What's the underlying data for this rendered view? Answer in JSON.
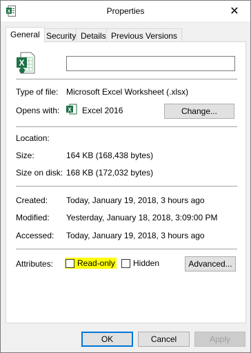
{
  "window": {
    "title": "Properties",
    "close_glyph": "✕",
    "title_icon": "excel-file-icon"
  },
  "tabs": [
    {
      "label": "General",
      "active": true
    },
    {
      "label": "Security",
      "active": false
    },
    {
      "label": "Details",
      "active": false
    },
    {
      "label": "Previous Versions",
      "active": false
    }
  ],
  "general": {
    "file_icon": "excel-file-icon",
    "file_name_value": "",
    "type_label": "Type of file:",
    "type_value": "Microsoft Excel Worksheet (.xlsx)",
    "opens_label": "Opens with:",
    "opens_app_icon": "excel-app-icon",
    "opens_value": "Excel 2016",
    "change_button": "Change...",
    "location_label": "Location:",
    "location_value": "",
    "size_label": "Size:",
    "size_value": "164 KB (168,438 bytes)",
    "size_on_disk_label": "Size on disk:",
    "size_on_disk_value": "168 KB (172,032 bytes)",
    "created_label": "Created:",
    "created_value": "Today, January 19, 2018, 3 hours ago",
    "modified_label": "Modified:",
    "modified_value": "Yesterday, January 18, 2018, 3:09:00 PM",
    "accessed_label": "Accessed:",
    "accessed_value": "Today, January 19, 2018, 3 hours ago",
    "attributes_label": "Attributes:",
    "readonly_label": "Read-only",
    "readonly_checked": false,
    "hidden_label": "Hidden",
    "hidden_checked": false,
    "advanced_button": "Advanced..."
  },
  "footer": {
    "ok_button": "OK",
    "cancel_button": "Cancel",
    "apply_button": "Apply"
  },
  "colors": {
    "highlight": "#ffff00",
    "excel_green": "#1e7145",
    "focus_border": "#0078d7"
  }
}
